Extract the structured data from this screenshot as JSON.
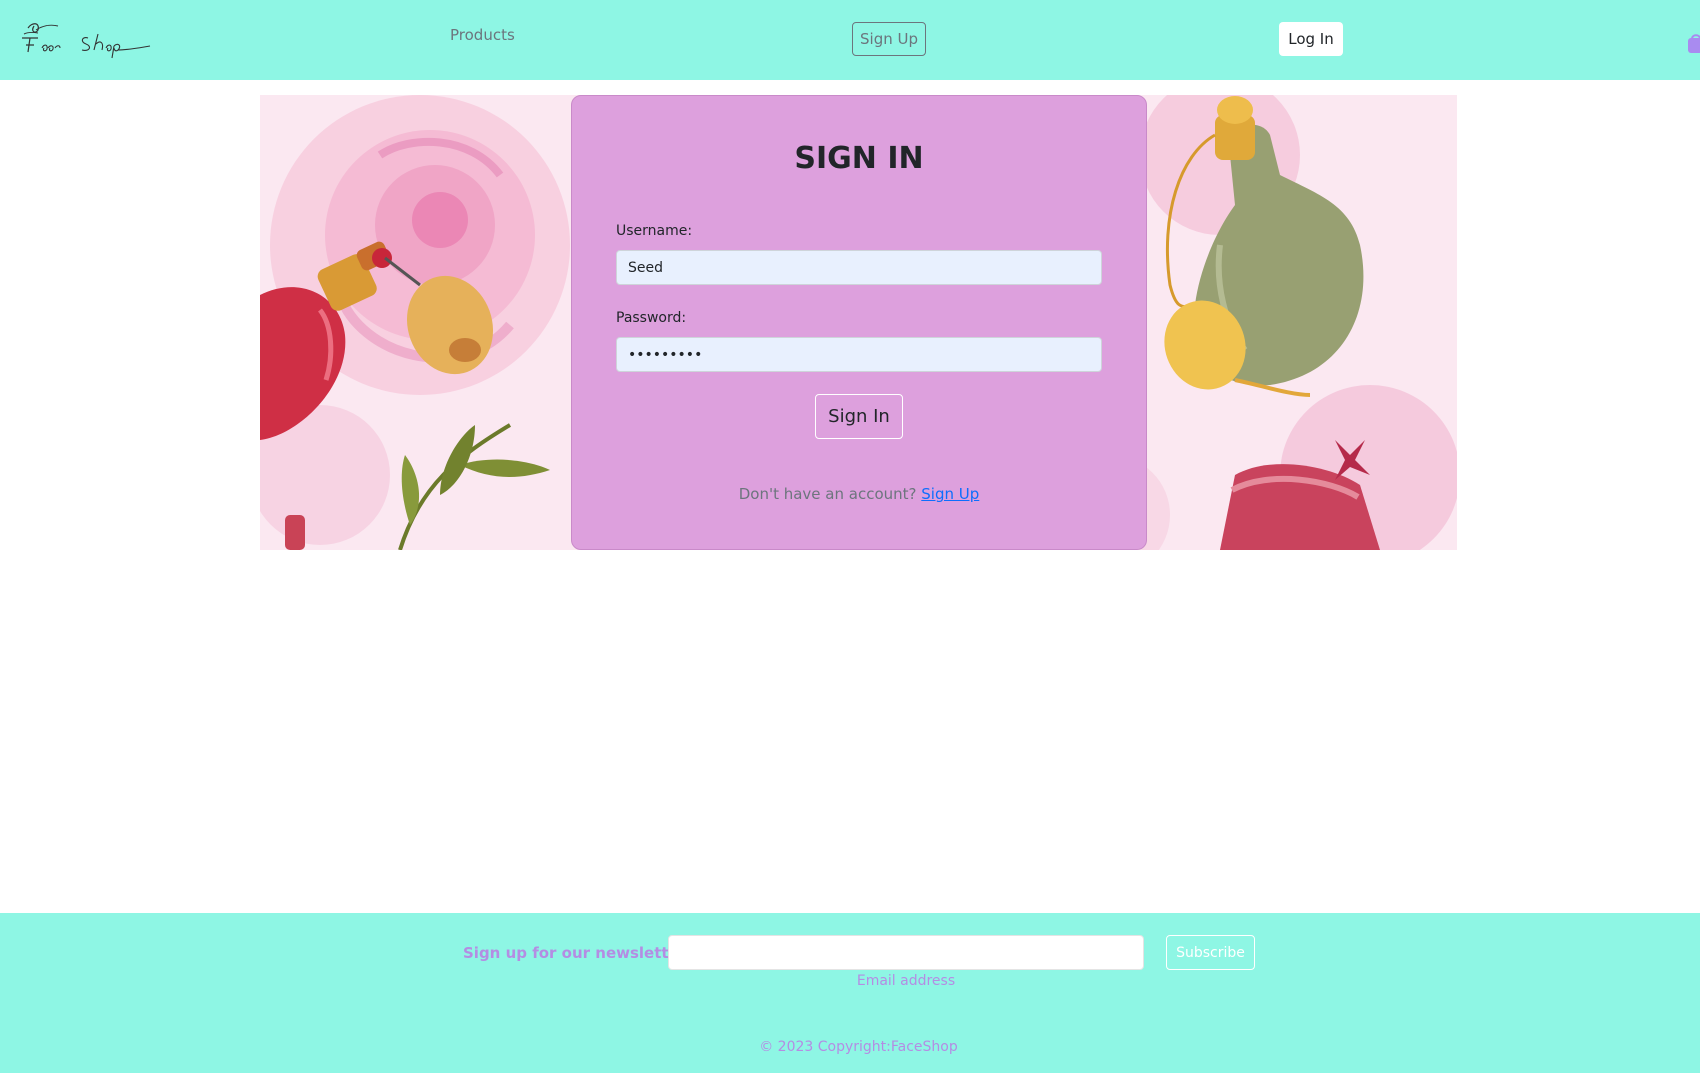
{
  "navbar": {
    "logo_text": "Face Shop",
    "products_label": "Products",
    "signup_label": "Sign Up",
    "login_label": "Log In"
  },
  "signin": {
    "title": "SIGN IN",
    "username_label": "Username:",
    "username_value": "Seed",
    "password_label": "Password:",
    "password_value": "•••••••••",
    "button_label": "Sign In",
    "no_account_text": "Don't have an account?",
    "signup_link": "Sign Up"
  },
  "footer": {
    "newsletter_label": "Sign up for our newsletter",
    "email_hint": "Email address",
    "subscribe_label": "Subscribe",
    "copyright": "© 2023 Copyright:FaceShop"
  },
  "colors": {
    "navbar_bg": "#8ef6e4",
    "card_bg": "#dda0dd",
    "accent_text": "#b48de3",
    "link": "#0d6efd"
  },
  "icons": [
    "logo-flower-icon",
    "shopping-bag-icon"
  ]
}
